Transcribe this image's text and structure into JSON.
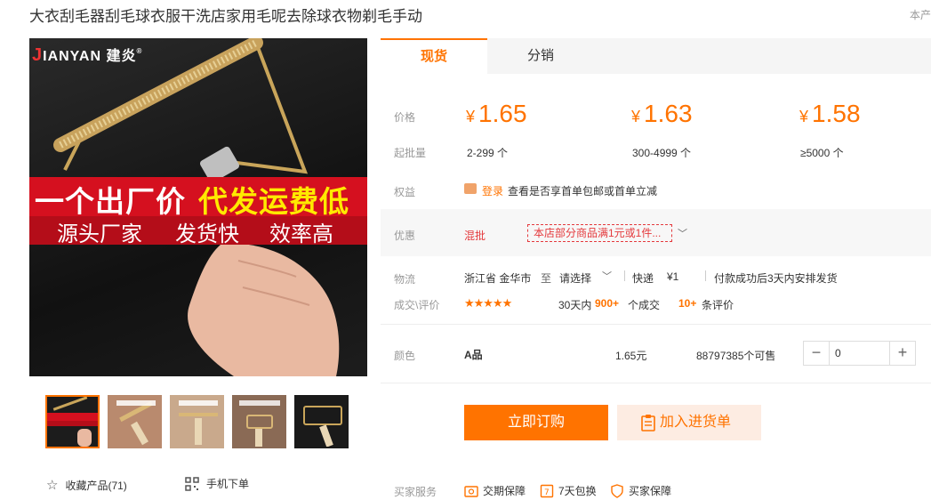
{
  "product": {
    "title": "大衣刮毛器刮毛球衣服干洗店家用毛呢去除球衣物剃毛手动",
    "store_label": "本产"
  },
  "image": {
    "logo_j": "J",
    "logo_text": "IANYAN 建炎",
    "logo_reg": "®",
    "banner_left": "一个出厂价",
    "banner_right": "代发运费低",
    "banner2": [
      "源头厂家",
      "发货快",
      "效率高"
    ]
  },
  "gallery": {
    "favorite_label": "收藏产品(71)",
    "mobile_order_label": "手机下单"
  },
  "tabs": [
    {
      "label": "现货",
      "active": true
    },
    {
      "label": "分销",
      "active": false
    }
  ],
  "pricing": {
    "price_label": "价格",
    "currency": "¥",
    "moq_label": "起批量",
    "tiers": [
      {
        "price": "1.65",
        "range": "2-299 个"
      },
      {
        "price": "1.63",
        "range": "300-4999 个"
      },
      {
        "price": "1.58",
        "range": "≥5000 个"
      }
    ]
  },
  "rights": {
    "label": "权益",
    "login_link": "登录",
    "text": "查看是否享首单包邮或首单立减"
  },
  "promo": {
    "label": "优惠",
    "type": "混批",
    "coupon": "本店部分商品满1元或1件..."
  },
  "logistics": {
    "label": "物流",
    "origin": "浙江省 金华市",
    "to": "至",
    "destination": "请选择",
    "express": "快递",
    "fee": "¥1",
    "ship_note": "付款成功后3天内安排发货"
  },
  "reviews": {
    "label": "成交\\评价",
    "stars": "★★★★★",
    "rating": 4.5,
    "period": "30天内",
    "deals": "900+",
    "deals_suffix": "个成交",
    "review_count": "10+",
    "review_suffix": "条评价"
  },
  "sku": {
    "label": "颜色",
    "name": "A品",
    "price": "1.65元",
    "stock": "88797385个可售",
    "quantity": "0",
    "minus": "−",
    "plus": "+"
  },
  "actions": {
    "buy_now": "立即订购",
    "add_cart": "加入进货单"
  },
  "services": {
    "label": "买家服务",
    "items": [
      "交期保障",
      "7天包换",
      "买家保障"
    ]
  },
  "colors": {
    "accent": "#ff7300",
    "coupon_red": "#e4393c",
    "banner_red": "#d5101f"
  }
}
